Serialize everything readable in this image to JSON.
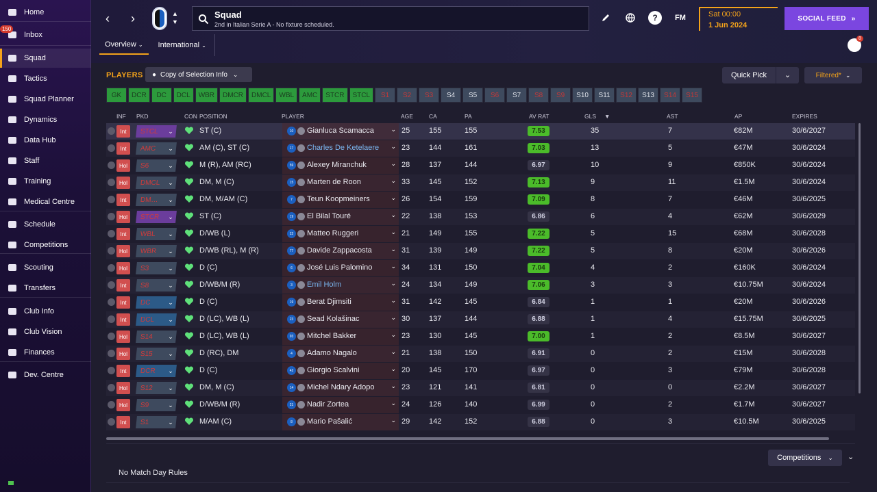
{
  "sidebar": {
    "items": [
      {
        "label": "Home",
        "icon": "home-icon"
      },
      {
        "label": "Inbox",
        "icon": "inbox-icon",
        "badge": "150"
      },
      {
        "label": "Squad",
        "icon": "squad-shirt-icon",
        "active": true
      },
      {
        "label": "Tactics",
        "icon": "tactics-icon"
      },
      {
        "label": "Squad Planner",
        "icon": "squad-planner-icon"
      },
      {
        "label": "Dynamics",
        "icon": "dynamics-icon"
      },
      {
        "label": "Data Hub",
        "icon": "data-hub-icon"
      },
      {
        "label": "Staff",
        "icon": "staff-icon"
      },
      {
        "label": "Training",
        "icon": "training-icon"
      },
      {
        "label": "Medical Centre",
        "icon": "medical-icon"
      },
      {
        "label": "Schedule",
        "icon": "schedule-icon"
      },
      {
        "label": "Competitions",
        "icon": "trophy-icon"
      },
      {
        "label": "Scouting",
        "icon": "scouting-icon"
      },
      {
        "label": "Transfers",
        "icon": "transfers-icon"
      },
      {
        "label": "Club Info",
        "icon": "club-info-icon"
      },
      {
        "label": "Club Vision",
        "icon": "club-vision-icon"
      },
      {
        "label": "Finances",
        "icon": "finances-icon"
      },
      {
        "label": "Dev. Centre",
        "icon": "dev-centre-icon"
      }
    ]
  },
  "header": {
    "title": "Squad",
    "subtitle": "2nd in Italian Serie A - No fixture scheduled.",
    "date_line1": "Sat 00:00",
    "date_line2": "1 Jun 2024",
    "social_feed": "SOCIAL FEED",
    "fm_label": "FM",
    "help_label": "?",
    "tabs": [
      {
        "label": "Overview"
      },
      {
        "label": "International"
      }
    ],
    "messages_badge": "8"
  },
  "toolbar": {
    "players_title": "PLAYERS",
    "copy_label": "Copy of Selection Info",
    "quick_pick": "Quick Pick",
    "filtered": "Filtered*"
  },
  "positions": [
    {
      "label": "GK",
      "state": "g"
    },
    {
      "label": "DCR",
      "state": "g"
    },
    {
      "label": "DC",
      "state": "g"
    },
    {
      "label": "DCL",
      "state": "g"
    },
    {
      "label": "WBR",
      "state": "g"
    },
    {
      "label": "DMCR",
      "state": "g"
    },
    {
      "label": "DMCL",
      "state": "g"
    },
    {
      "label": "WBL",
      "state": "g"
    },
    {
      "label": "AMC",
      "state": "g"
    },
    {
      "label": "STCR",
      "state": "g"
    },
    {
      "label": "STCL",
      "state": "g"
    },
    {
      "label": "S1",
      "state": "r"
    },
    {
      "label": "S2",
      "state": "r"
    },
    {
      "label": "S3",
      "state": "r"
    },
    {
      "label": "S4",
      "state": "s"
    },
    {
      "label": "S5",
      "state": "s"
    },
    {
      "label": "S6",
      "state": "r"
    },
    {
      "label": "S7",
      "state": "s"
    },
    {
      "label": "S8",
      "state": "r"
    },
    {
      "label": "S9",
      "state": "r"
    },
    {
      "label": "S10",
      "state": "s"
    },
    {
      "label": "S11",
      "state": "s"
    },
    {
      "label": "S12",
      "state": "r"
    },
    {
      "label": "S13",
      "state": "s"
    },
    {
      "label": "S14",
      "state": "r"
    },
    {
      "label": "S15",
      "state": "r"
    }
  ],
  "columns": {
    "inf": "INF",
    "pkd": "PKD",
    "con": "CON",
    "position": "POSITION",
    "player": "PLAYER",
    "age": "AGE",
    "ca": "CA",
    "pa": "PA",
    "av_rat": "AV RAT",
    "gls": "GLS",
    "ast": "AST",
    "ap": "AP",
    "expires": "EXPIRES"
  },
  "players": [
    {
      "inf": "Int",
      "pkd": "STCL",
      "pkd_color": "purple",
      "position": "ST (C)",
      "number": "10",
      "name": "Gianluca Scamacca",
      "link": false,
      "age": "25",
      "ca": "155",
      "pa": "155",
      "rating": "7.53",
      "rating_hi": true,
      "gls": "35",
      "ast": "7",
      "ap": "€82M",
      "expires": "30/6/2027"
    },
    {
      "inf": "Int",
      "pkd": "AMC",
      "pkd_color": "gray",
      "position": "AM (C), ST (C)",
      "number": "17",
      "name": "Charles De Ketelaere",
      "link": true,
      "age": "23",
      "ca": "144",
      "pa": "161",
      "rating": "7.03",
      "rating_hi": true,
      "gls": "13",
      "ast": "5",
      "ap": "€47M",
      "expires": "30/6/2024"
    },
    {
      "inf": "Hol",
      "pkd": "S6",
      "pkd_color": "gray",
      "position": "M (R), AM (RC)",
      "number": "59",
      "name": "Alexey Miranchuk",
      "link": false,
      "age": "28",
      "ca": "137",
      "pa": "144",
      "rating": "6.97",
      "rating_hi": false,
      "gls": "10",
      "ast": "9",
      "ap": "€850K",
      "expires": "30/6/2024"
    },
    {
      "inf": "Hol",
      "pkd": "DMCL",
      "pkd_color": "gray",
      "position": "DM, M (C)",
      "number": "15",
      "name": "Marten de Roon",
      "link": false,
      "age": "33",
      "ca": "145",
      "pa": "152",
      "rating": "7.13",
      "rating_hi": true,
      "gls": "9",
      "ast": "11",
      "ap": "€1.5M",
      "expires": "30/6/2024"
    },
    {
      "inf": "Int",
      "pkd": "DM…",
      "pkd_color": "gray",
      "position": "DM, M/AM (C)",
      "number": "7",
      "name": "Teun Koopmeiners",
      "link": false,
      "age": "26",
      "ca": "154",
      "pa": "159",
      "rating": "7.09",
      "rating_hi": true,
      "gls": "8",
      "ast": "7",
      "ap": "€46M",
      "expires": "30/6/2025"
    },
    {
      "inf": "Hol",
      "pkd": "STCR",
      "pkd_color": "purple",
      "position": "ST (C)",
      "number": "19",
      "name": "El Bilal Touré",
      "link": false,
      "age": "22",
      "ca": "138",
      "pa": "153",
      "rating": "6.86",
      "rating_hi": false,
      "gls": "6",
      "ast": "4",
      "ap": "€62M",
      "expires": "30/6/2029"
    },
    {
      "inf": "Int",
      "pkd": "WBL",
      "pkd_color": "gray",
      "position": "D/WB (L)",
      "number": "22",
      "name": "Matteo Ruggeri",
      "link": false,
      "age": "21",
      "ca": "149",
      "pa": "155",
      "rating": "7.22",
      "rating_hi": true,
      "gls": "5",
      "ast": "15",
      "ap": "€68M",
      "expires": "30/6/2028"
    },
    {
      "inf": "Hol",
      "pkd": "WBR",
      "pkd_color": "gray",
      "position": "D/WB (RL), M (R)",
      "number": "77",
      "name": "Davide Zappacosta",
      "link": false,
      "age": "31",
      "ca": "139",
      "pa": "149",
      "rating": "7.22",
      "rating_hi": true,
      "gls": "5",
      "ast": "8",
      "ap": "€20M",
      "expires": "30/6/2026"
    },
    {
      "inf": "Hol",
      "pkd": "S3",
      "pkd_color": "gray",
      "position": "D (C)",
      "number": "6",
      "name": "José Luis Palomino",
      "link": false,
      "age": "34",
      "ca": "131",
      "pa": "150",
      "rating": "7.04",
      "rating_hi": true,
      "gls": "4",
      "ast": "2",
      "ap": "€160K",
      "expires": "30/6/2024"
    },
    {
      "inf": "Int",
      "pkd": "S8",
      "pkd_color": "gray",
      "position": "D/WB/M (R)",
      "number": "3",
      "name": "Emil Holm",
      "link": true,
      "age": "24",
      "ca": "134",
      "pa": "149",
      "rating": "7.06",
      "rating_hi": true,
      "gls": "3",
      "ast": "3",
      "ap": "€10.75M",
      "expires": "30/6/2024"
    },
    {
      "inf": "Int",
      "pkd": "DC",
      "pkd_color": "blue",
      "position": "D (C)",
      "number": "19",
      "name": "Berat Djimsiti",
      "link": false,
      "age": "31",
      "ca": "142",
      "pa": "145",
      "rating": "6.84",
      "rating_hi": false,
      "gls": "1",
      "ast": "1",
      "ap": "€20M",
      "expires": "30/6/2026"
    },
    {
      "inf": "Int",
      "pkd": "DCL",
      "pkd_color": "blue",
      "position": "D (LC), WB (L)",
      "number": "23",
      "name": "Sead Kolašinac",
      "link": false,
      "age": "30",
      "ca": "137",
      "pa": "144",
      "rating": "6.88",
      "rating_hi": false,
      "gls": "1",
      "ast": "4",
      "ap": "€15.75M",
      "expires": "30/6/2025"
    },
    {
      "inf": "Hol",
      "pkd": "S14",
      "pkd_color": "gray",
      "position": "D (LC), WB (L)",
      "number": "93",
      "name": "Mitchel Bakker",
      "link": false,
      "age": "23",
      "ca": "130",
      "pa": "145",
      "rating": "7.00",
      "rating_hi": true,
      "gls": "1",
      "ast": "2",
      "ap": "€8.5M",
      "expires": "30/6/2027"
    },
    {
      "inf": "Hol",
      "pkd": "S15",
      "pkd_color": "gray",
      "position": "D (RC), DM",
      "number": "4",
      "name": "Adamo Nagalo",
      "link": false,
      "age": "21",
      "ca": "138",
      "pa": "150",
      "rating": "6.91",
      "rating_hi": false,
      "gls": "0",
      "ast": "2",
      "ap": "€15M",
      "expires": "30/6/2028"
    },
    {
      "inf": "Int",
      "pkd": "DCR",
      "pkd_color": "blue",
      "position": "D (C)",
      "number": "42",
      "name": "Giorgio Scalvini",
      "link": false,
      "age": "20",
      "ca": "145",
      "pa": "170",
      "rating": "6.97",
      "rating_hi": false,
      "gls": "0",
      "ast": "3",
      "ap": "€79M",
      "expires": "30/6/2028"
    },
    {
      "inf": "Hol",
      "pkd": "S12",
      "pkd_color": "gray",
      "position": "DM, M (C)",
      "number": "14",
      "name": "Michel Ndary Adopo",
      "link": false,
      "age": "23",
      "ca": "121",
      "pa": "141",
      "rating": "6.81",
      "rating_hi": false,
      "gls": "0",
      "ast": "0",
      "ap": "€2.2M",
      "expires": "30/6/2027"
    },
    {
      "inf": "Hol",
      "pkd": "S9",
      "pkd_color": "gray",
      "position": "D/WB/M (R)",
      "number": "21",
      "name": "Nadir Zortea",
      "link": false,
      "age": "24",
      "ca": "126",
      "pa": "140",
      "rating": "6.99",
      "rating_hi": false,
      "gls": "0",
      "ast": "2",
      "ap": "€1.7M",
      "expires": "30/6/2027"
    },
    {
      "inf": "Int",
      "pkd": "S1",
      "pkd_color": "gray",
      "position": "M/AM (C)",
      "number": "8",
      "name": "Mario Pašalić",
      "link": false,
      "age": "29",
      "ca": "142",
      "pa": "152",
      "rating": "6.88",
      "rating_hi": false,
      "gls": "0",
      "ast": "3",
      "ap": "€10.5M",
      "expires": "30/6/2025"
    }
  ],
  "bottom": {
    "competitions": "Competitions",
    "no_match": "No Match Day Rules"
  }
}
